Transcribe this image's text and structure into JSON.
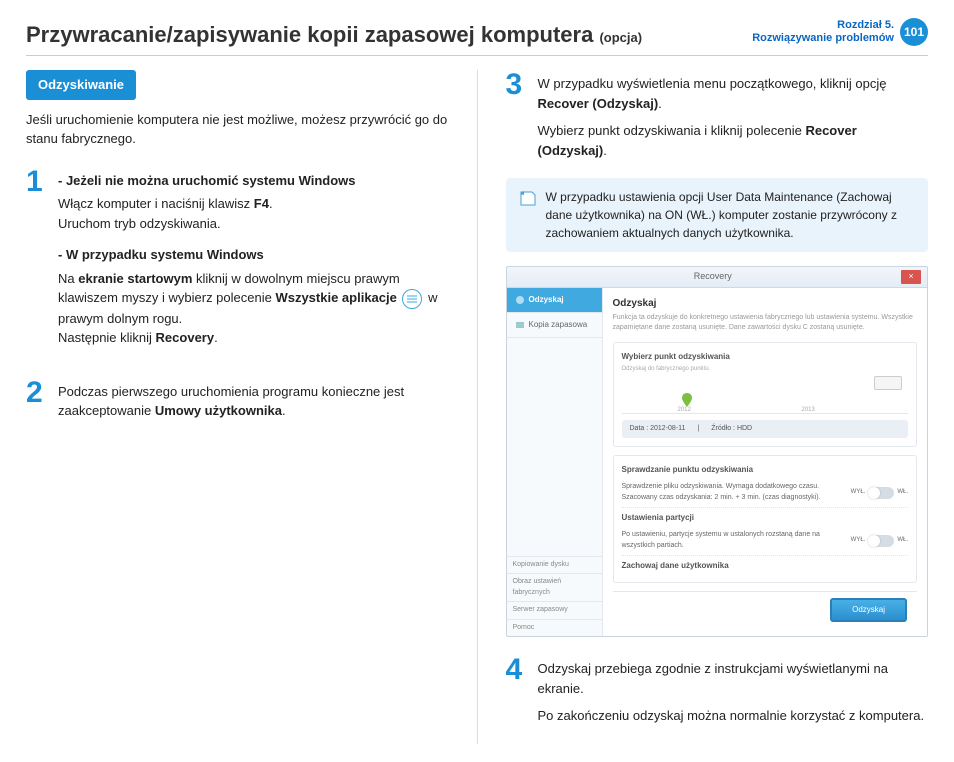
{
  "header": {
    "title_main": "Przywracanie/zapisywanie kopii zapasowej komputera ",
    "title_opt": "(opcja)",
    "chapter_l1": "Rozdział 5.",
    "chapter_l2": "Rozwiązywanie problemów",
    "page_number": "101"
  },
  "left": {
    "section_heading": "Odzyskiwanie",
    "intro": "Jeśli uruchomienie komputera nie jest możliwe, możesz przywrócić go do stanu fabrycznego.",
    "step1": {
      "sub1_h": "Jeżeli nie można uruchomić systemu Windows",
      "sub1_p1_a": "Włącz komputer i naciśnij klawisz ",
      "sub1_p1_b": "F4",
      "sub1_p1_c": ".",
      "sub1_p2": "Uruchom tryb odzyskiwania.",
      "sub2_h": "W przypadku systemu Windows",
      "sub2_p1_a": "Na ",
      "sub2_p1_b": "ekranie startowym",
      "sub2_p1_c": " kliknij w dowolnym miejscu prawym klawiszem myszy i wybierz polecenie ",
      "sub2_p1_d": "Wszystkie aplikacje",
      "sub2_p1_e": " w prawym dolnym rogu.",
      "sub2_p2_a": "Następnie kliknij ",
      "sub2_p2_b": "Recovery",
      "sub2_p2_c": "."
    },
    "step2_a": "Podczas pierwszego uruchomienia programu konieczne jest zaakceptowanie ",
    "step2_b": "Umowy użytkownika",
    "step2_c": "."
  },
  "right": {
    "step3_p1_a": "W przypadku wyświetlenia menu początkowego, kliknij opcję ",
    "step3_p1_b": "Recover (Odzyskaj)",
    "step3_p1_c": ".",
    "step3_p2_a": "Wybierz punkt odzyskiwania i kliknij polecenie ",
    "step3_p2_b": "Recover (Odzyskaj)",
    "step3_p2_c": ".",
    "note": "W przypadku ustawienia opcji User Data Maintenance (Zachowaj dane użytkownika) na ON (WŁ.) komputer zostanie przywrócony z zachowaniem aktualnych danych użytkownika.",
    "screenshot": {
      "window_title": "Recovery",
      "side_tab_active": "Odzyskaj",
      "side_tab_2": "Kopia zapasowa",
      "side_b1": "Kopiowanie dysku",
      "side_b2": "Obraz ustawień fabrycznych",
      "side_b3": "Serwer zapasowy",
      "side_b4": "Pomoc",
      "main_h": "Odzyskaj",
      "main_desc": "Funkcja ta odzyskuje do konkretnego ustawienia fabrycznego lub ustawienia systemu. Wszystkie zapamiętane dane zostaną usunięte. Dane zawartości dysku C zostaną usunięte.",
      "panel1_h": "Wybierz punkt odzyskiwania",
      "panel1_sub": "Odzyskaj do fabrycznego punktu.",
      "tl_y1": "2012",
      "tl_y2": "2013",
      "meta_date_l": "Data : ",
      "meta_date_v": "2012-08-11",
      "meta_src_l": "Źródło : ",
      "meta_src_v": "HDD",
      "panel2_h": "Sprawdzanie punktu odzyskiwania",
      "row1_t": "Sprawdzenie pliku odzyskiwania. Wymaga dodatkowego czasu. Szacowany czas odzyskania: 2 min. + 3 min. (czas diagnostyki).",
      "panel3_h": "Ustawienia partycji",
      "row2_t": "Po ustawieniu, partycje systemu w ustalonych rozstaną dane na wszystkich partiach.",
      "panel4_h": "Zachowaj dane użytkownika",
      "tog_off": "WYŁ.",
      "tog_on": "WŁ.",
      "btn": "Odzyskaj"
    },
    "step4_p1": "Odzyskaj przebiega zgodnie z instrukcjami wyświetlanymi na ekranie.",
    "step4_p2": "Po zakończeniu odzyskaj można normalnie korzystać z komputera."
  }
}
